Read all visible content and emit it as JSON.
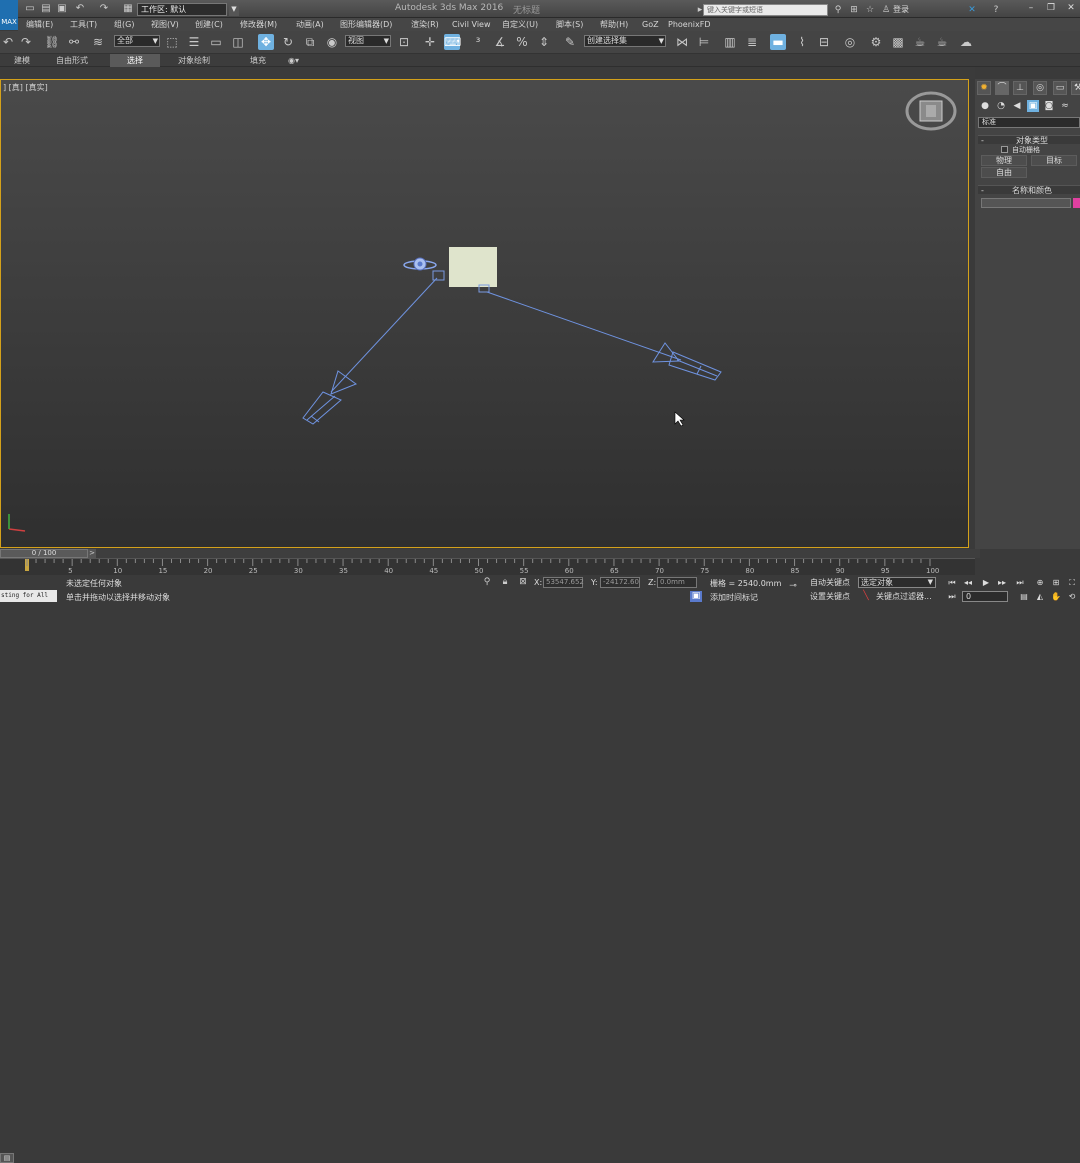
{
  "titlebar": {
    "app_logo": "MAX",
    "workspace": "工作区: 默认",
    "app_title": "Autodesk 3ds Max 2016",
    "file_title": "无标题",
    "search_placeholder": "键入关键字或短语",
    "login": "登录"
  },
  "menubar": [
    "编辑(E)",
    "工具(T)",
    "组(G)",
    "视图(V)",
    "创建(C)",
    "修改器(M)",
    "动画(A)",
    "图形编辑器(D)",
    "渲染(R)",
    "Civil View",
    "自定义(U)",
    "脚本(S)",
    "帮助(H)",
    "GoZ",
    "PhoenixFD"
  ],
  "toolbar": {
    "selection_filter": "全部",
    "ref_coord": "视图",
    "named_selection": "创建选择集"
  },
  "ribbon": {
    "tabs": [
      "建模",
      "自由形式",
      "选择",
      "对象绘制",
      "填充"
    ],
    "active": "选择"
  },
  "viewport": {
    "label": "] [真] [真实]"
  },
  "command_panel": {
    "dropdown": "标准",
    "object_type": {
      "title": "对象类型",
      "autogrid": "自动栅格",
      "buttons": [
        "物理",
        "目标",
        "自由"
      ]
    },
    "name_color": {
      "title": "名称和颜色"
    }
  },
  "timeline": {
    "slider": "0 / 100",
    "next_symbol": ">",
    "tick_labels": [
      "5",
      "10",
      "15",
      "20",
      "25",
      "30",
      "35",
      "40",
      "45",
      "50",
      "55",
      "60",
      "65",
      "70",
      "75",
      "80",
      "85",
      "90",
      "95",
      "100"
    ]
  },
  "status": {
    "maxscript": "sting for All",
    "selection_text": "未选定任何对象",
    "prompt_text": "单击并拖动以选择并移动对象",
    "x_label": "X:",
    "x_value": "53547.652",
    "y_label": "Y:",
    "y_value": "-24172.60",
    "z_label": "Z:",
    "z_value": "0.0mm",
    "grid": "栅格 = 2540.0mm",
    "add_time_tag": "添加时间标记",
    "auto_key": "自动关键点",
    "set_key": "设置关键点",
    "selected_dropdown": "选定对象",
    "key_filters": "关键点过滤器...",
    "frame": "0"
  },
  "colors": {
    "viewport_border": "#d4a11a",
    "wireframe": "#6f93e0",
    "key_swatch": "#e040a0"
  }
}
